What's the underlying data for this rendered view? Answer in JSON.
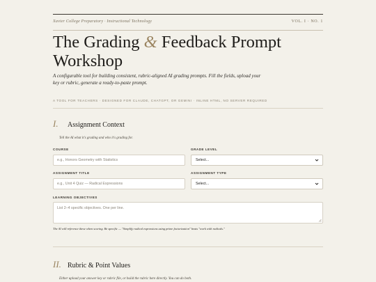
{
  "masthead": {
    "institution": "Xavier College Preparatory · Instructional Technology",
    "issue": "VOL. I · NO. 1"
  },
  "title": {
    "part1": "The Grading ",
    "amp": "&",
    "part2": " Feedback Prompt Workshop"
  },
  "lede": "A configurable tool for building consistent, rubric-aligned AI grading prompts. Fill the fields, upload your key or rubric, generate a ready-to-paste prompt.",
  "tagline": "A TOOL FOR TEACHERS · DESIGNED FOR CLAUDE, CHATGPT, OR GEMINI · INLINE HTML, NO SERVER REQUIRED",
  "section1": {
    "number": "I.",
    "title": "Assignment Context",
    "subtitle": "Tell the AI what it's grading and who it's grading for.",
    "course": {
      "label": "COURSE",
      "placeholder": "e.g., Honors Geometry with Statistics"
    },
    "grade_level": {
      "label": "GRADE LEVEL",
      "selected": "Select..."
    },
    "assignment_title": {
      "label": "ASSIGNMENT TITLE",
      "placeholder": "e.g., Unit 4 Quiz — Radical Expressions"
    },
    "assignment_type": {
      "label": "ASSIGNMENT TYPE",
      "selected": "Select..."
    },
    "objectives": {
      "label": "LEARNING OBJECTIVES",
      "placeholder": "List 2–4 specific objectives. One per line."
    },
    "hint": "The AI will reference these when scoring. Be specific — \"Simplify radical expressions using prime factorization\" beats \"work with radicals.\""
  },
  "section2": {
    "number": "II.",
    "title": "Rubric & Point Values",
    "subtitle": "Either upload your answer key or rubric file, or build the rubric here directly. You can do both."
  },
  "colors": {
    "background": "#f3f1ea",
    "accent": "#9a8460",
    "text": "#1f1d1a"
  },
  "icons": {
    "select_arrow": "chevron-down-icon",
    "textarea_resize": "resize-grip-icon"
  }
}
